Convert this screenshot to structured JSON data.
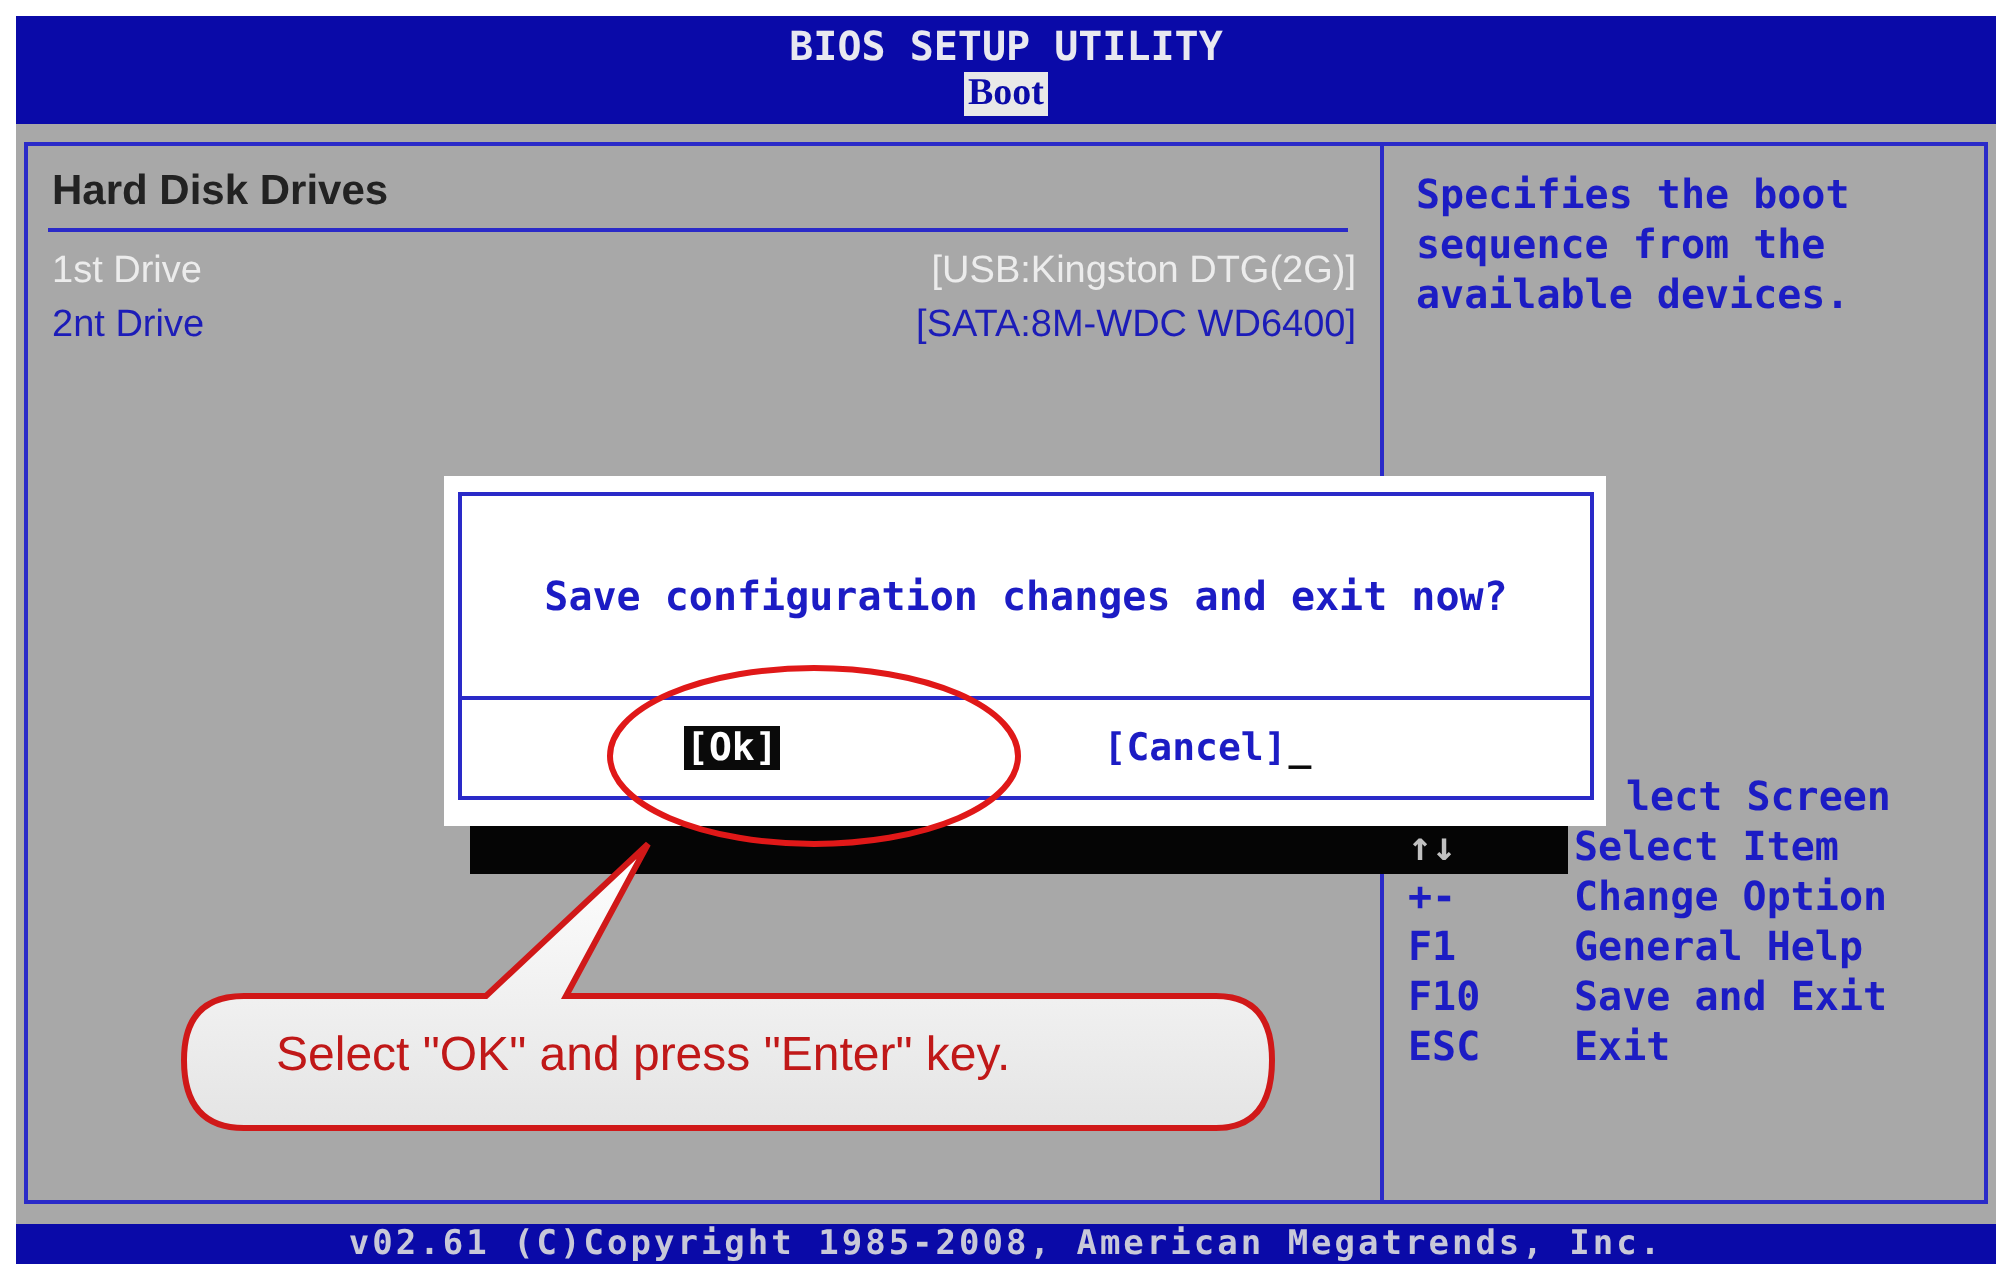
{
  "window": {
    "title": "BIOS SETUP UTILITY"
  },
  "tabs": [
    {
      "label": "Boot",
      "selected": true
    }
  ],
  "panel": {
    "heading": "Hard Disk Drives",
    "rows": [
      {
        "label": "1st Drive",
        "value": "[USB:Kingston DTG(2G)]",
        "selected": true
      },
      {
        "label": "2nt Drive",
        "value": "[SATA:8M-WDC WD6400]",
        "selected": false
      }
    ]
  },
  "help": {
    "description": "Specifies the boot sequence from the available devices.",
    "keys": [
      {
        "kind": "partial",
        "action": "lect Screen"
      },
      {
        "kind": "shaded",
        "key": "↑↓",
        "action": "Select Item"
      },
      {
        "kind": "plain",
        "key": "+-",
        "action": "Change Option"
      },
      {
        "kind": "plain",
        "key": "F1",
        "action": "General Help"
      },
      {
        "kind": "plain",
        "key": "F10",
        "action": "Save and Exit"
      },
      {
        "kind": "plain",
        "key": "ESC",
        "action": "Exit"
      }
    ]
  },
  "dialog": {
    "message": "Save configuration changes and exit now?",
    "buttons": [
      {
        "label": "[Ok]",
        "selected": true
      },
      {
        "label": "[Cancel]",
        "selected": false
      }
    ],
    "cursor": "_"
  },
  "callout": {
    "text": "Select \"OK\" and press \"Enter\" key."
  },
  "status_bar": "v02.61 (C)Copyright 1985-2008, American Megatrends, Inc."
}
